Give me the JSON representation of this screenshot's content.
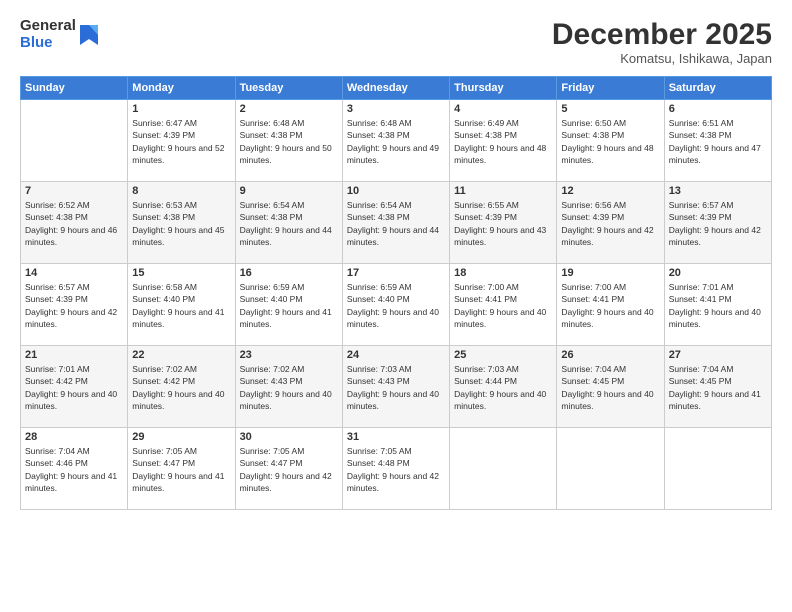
{
  "logo": {
    "general": "General",
    "blue": "Blue"
  },
  "header": {
    "month": "December 2025",
    "location": "Komatsu, Ishikawa, Japan"
  },
  "days": [
    "Sunday",
    "Monday",
    "Tuesday",
    "Wednesday",
    "Thursday",
    "Friday",
    "Saturday"
  ],
  "weeks": [
    [
      {
        "day": "",
        "sunrise": "",
        "sunset": "",
        "daylight": ""
      },
      {
        "day": "1",
        "sunrise": "Sunrise: 6:47 AM",
        "sunset": "Sunset: 4:39 PM",
        "daylight": "Daylight: 9 hours and 52 minutes."
      },
      {
        "day": "2",
        "sunrise": "Sunrise: 6:48 AM",
        "sunset": "Sunset: 4:38 PM",
        "daylight": "Daylight: 9 hours and 50 minutes."
      },
      {
        "day": "3",
        "sunrise": "Sunrise: 6:48 AM",
        "sunset": "Sunset: 4:38 PM",
        "daylight": "Daylight: 9 hours and 49 minutes."
      },
      {
        "day": "4",
        "sunrise": "Sunrise: 6:49 AM",
        "sunset": "Sunset: 4:38 PM",
        "daylight": "Daylight: 9 hours and 48 minutes."
      },
      {
        "day": "5",
        "sunrise": "Sunrise: 6:50 AM",
        "sunset": "Sunset: 4:38 PM",
        "daylight": "Daylight: 9 hours and 48 minutes."
      },
      {
        "day": "6",
        "sunrise": "Sunrise: 6:51 AM",
        "sunset": "Sunset: 4:38 PM",
        "daylight": "Daylight: 9 hours and 47 minutes."
      }
    ],
    [
      {
        "day": "7",
        "sunrise": "Sunrise: 6:52 AM",
        "sunset": "Sunset: 4:38 PM",
        "daylight": "Daylight: 9 hours and 46 minutes."
      },
      {
        "day": "8",
        "sunrise": "Sunrise: 6:53 AM",
        "sunset": "Sunset: 4:38 PM",
        "daylight": "Daylight: 9 hours and 45 minutes."
      },
      {
        "day": "9",
        "sunrise": "Sunrise: 6:54 AM",
        "sunset": "Sunset: 4:38 PM",
        "daylight": "Daylight: 9 hours and 44 minutes."
      },
      {
        "day": "10",
        "sunrise": "Sunrise: 6:54 AM",
        "sunset": "Sunset: 4:38 PM",
        "daylight": "Daylight: 9 hours and 44 minutes."
      },
      {
        "day": "11",
        "sunrise": "Sunrise: 6:55 AM",
        "sunset": "Sunset: 4:39 PM",
        "daylight": "Daylight: 9 hours and 43 minutes."
      },
      {
        "day": "12",
        "sunrise": "Sunrise: 6:56 AM",
        "sunset": "Sunset: 4:39 PM",
        "daylight": "Daylight: 9 hours and 42 minutes."
      },
      {
        "day": "13",
        "sunrise": "Sunrise: 6:57 AM",
        "sunset": "Sunset: 4:39 PM",
        "daylight": "Daylight: 9 hours and 42 minutes."
      }
    ],
    [
      {
        "day": "14",
        "sunrise": "Sunrise: 6:57 AM",
        "sunset": "Sunset: 4:39 PM",
        "daylight": "Daylight: 9 hours and 42 minutes."
      },
      {
        "day": "15",
        "sunrise": "Sunrise: 6:58 AM",
        "sunset": "Sunset: 4:40 PM",
        "daylight": "Daylight: 9 hours and 41 minutes."
      },
      {
        "day": "16",
        "sunrise": "Sunrise: 6:59 AM",
        "sunset": "Sunset: 4:40 PM",
        "daylight": "Daylight: 9 hours and 41 minutes."
      },
      {
        "day": "17",
        "sunrise": "Sunrise: 6:59 AM",
        "sunset": "Sunset: 4:40 PM",
        "daylight": "Daylight: 9 hours and 40 minutes."
      },
      {
        "day": "18",
        "sunrise": "Sunrise: 7:00 AM",
        "sunset": "Sunset: 4:41 PM",
        "daylight": "Daylight: 9 hours and 40 minutes."
      },
      {
        "day": "19",
        "sunrise": "Sunrise: 7:00 AM",
        "sunset": "Sunset: 4:41 PM",
        "daylight": "Daylight: 9 hours and 40 minutes."
      },
      {
        "day": "20",
        "sunrise": "Sunrise: 7:01 AM",
        "sunset": "Sunset: 4:41 PM",
        "daylight": "Daylight: 9 hours and 40 minutes."
      }
    ],
    [
      {
        "day": "21",
        "sunrise": "Sunrise: 7:01 AM",
        "sunset": "Sunset: 4:42 PM",
        "daylight": "Daylight: 9 hours and 40 minutes."
      },
      {
        "day": "22",
        "sunrise": "Sunrise: 7:02 AM",
        "sunset": "Sunset: 4:42 PM",
        "daylight": "Daylight: 9 hours and 40 minutes."
      },
      {
        "day": "23",
        "sunrise": "Sunrise: 7:02 AM",
        "sunset": "Sunset: 4:43 PM",
        "daylight": "Daylight: 9 hours and 40 minutes."
      },
      {
        "day": "24",
        "sunrise": "Sunrise: 7:03 AM",
        "sunset": "Sunset: 4:43 PM",
        "daylight": "Daylight: 9 hours and 40 minutes."
      },
      {
        "day": "25",
        "sunrise": "Sunrise: 7:03 AM",
        "sunset": "Sunset: 4:44 PM",
        "daylight": "Daylight: 9 hours and 40 minutes."
      },
      {
        "day": "26",
        "sunrise": "Sunrise: 7:04 AM",
        "sunset": "Sunset: 4:45 PM",
        "daylight": "Daylight: 9 hours and 40 minutes."
      },
      {
        "day": "27",
        "sunrise": "Sunrise: 7:04 AM",
        "sunset": "Sunset: 4:45 PM",
        "daylight": "Daylight: 9 hours and 41 minutes."
      }
    ],
    [
      {
        "day": "28",
        "sunrise": "Sunrise: 7:04 AM",
        "sunset": "Sunset: 4:46 PM",
        "daylight": "Daylight: 9 hours and 41 minutes."
      },
      {
        "day": "29",
        "sunrise": "Sunrise: 7:05 AM",
        "sunset": "Sunset: 4:47 PM",
        "daylight": "Daylight: 9 hours and 41 minutes."
      },
      {
        "day": "30",
        "sunrise": "Sunrise: 7:05 AM",
        "sunset": "Sunset: 4:47 PM",
        "daylight": "Daylight: 9 hours and 42 minutes."
      },
      {
        "day": "31",
        "sunrise": "Sunrise: 7:05 AM",
        "sunset": "Sunset: 4:48 PM",
        "daylight": "Daylight: 9 hours and 42 minutes."
      },
      {
        "day": "",
        "sunrise": "",
        "sunset": "",
        "daylight": ""
      },
      {
        "day": "",
        "sunrise": "",
        "sunset": "",
        "daylight": ""
      },
      {
        "day": "",
        "sunrise": "",
        "sunset": "",
        "daylight": ""
      }
    ]
  ]
}
